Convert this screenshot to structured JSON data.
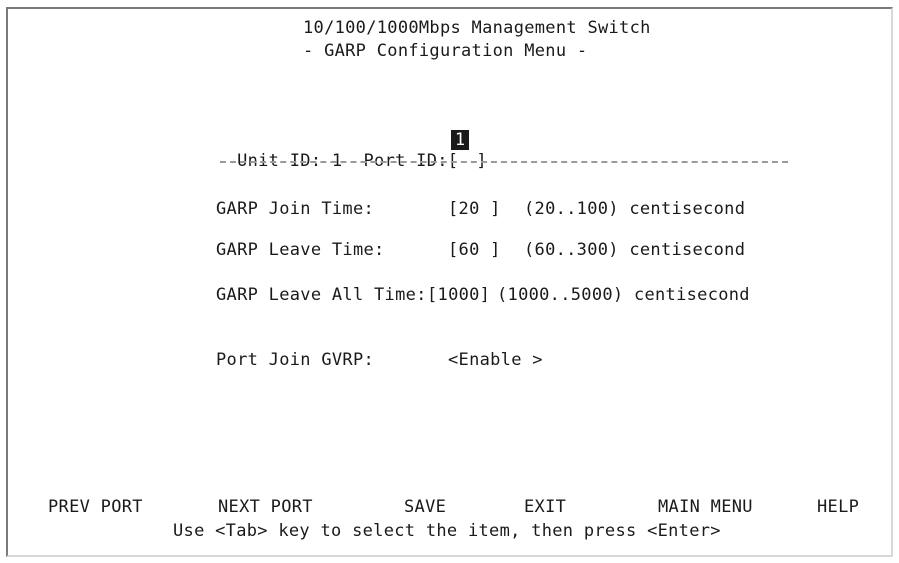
{
  "header": {
    "title": "10/100/1000Mbps Management Switch",
    "subtitle": "- GARP Configuration Menu -"
  },
  "unit": {
    "label": "Unit ID: 1  Port ID:",
    "bracket_open": "[",
    "port_value": "1",
    "bracket_close": "]"
  },
  "settings": [
    {
      "label": "GARP Join Time:",
      "value": "[20 ]",
      "range": "(20..100) centisecond"
    },
    {
      "label": "GARP Leave Time:",
      "value": "[60 ]",
      "range": "(60..300) centisecond"
    },
    {
      "label": "GARP Leave All Time:",
      "value": "[1000]",
      "range": "(1000..5000) centisecond"
    }
  ],
  "gvrp": {
    "label": "Port Join GVRP:",
    "value": "<Enable >"
  },
  "footer": {
    "prev_port": "PREV PORT",
    "next_port": "NEXT PORT",
    "save": "SAVE",
    "exit": "EXIT",
    "main_menu": "MAIN MENU",
    "help": "HELP",
    "hint": "Use <Tab> key to select the item, then press <Enter>"
  }
}
